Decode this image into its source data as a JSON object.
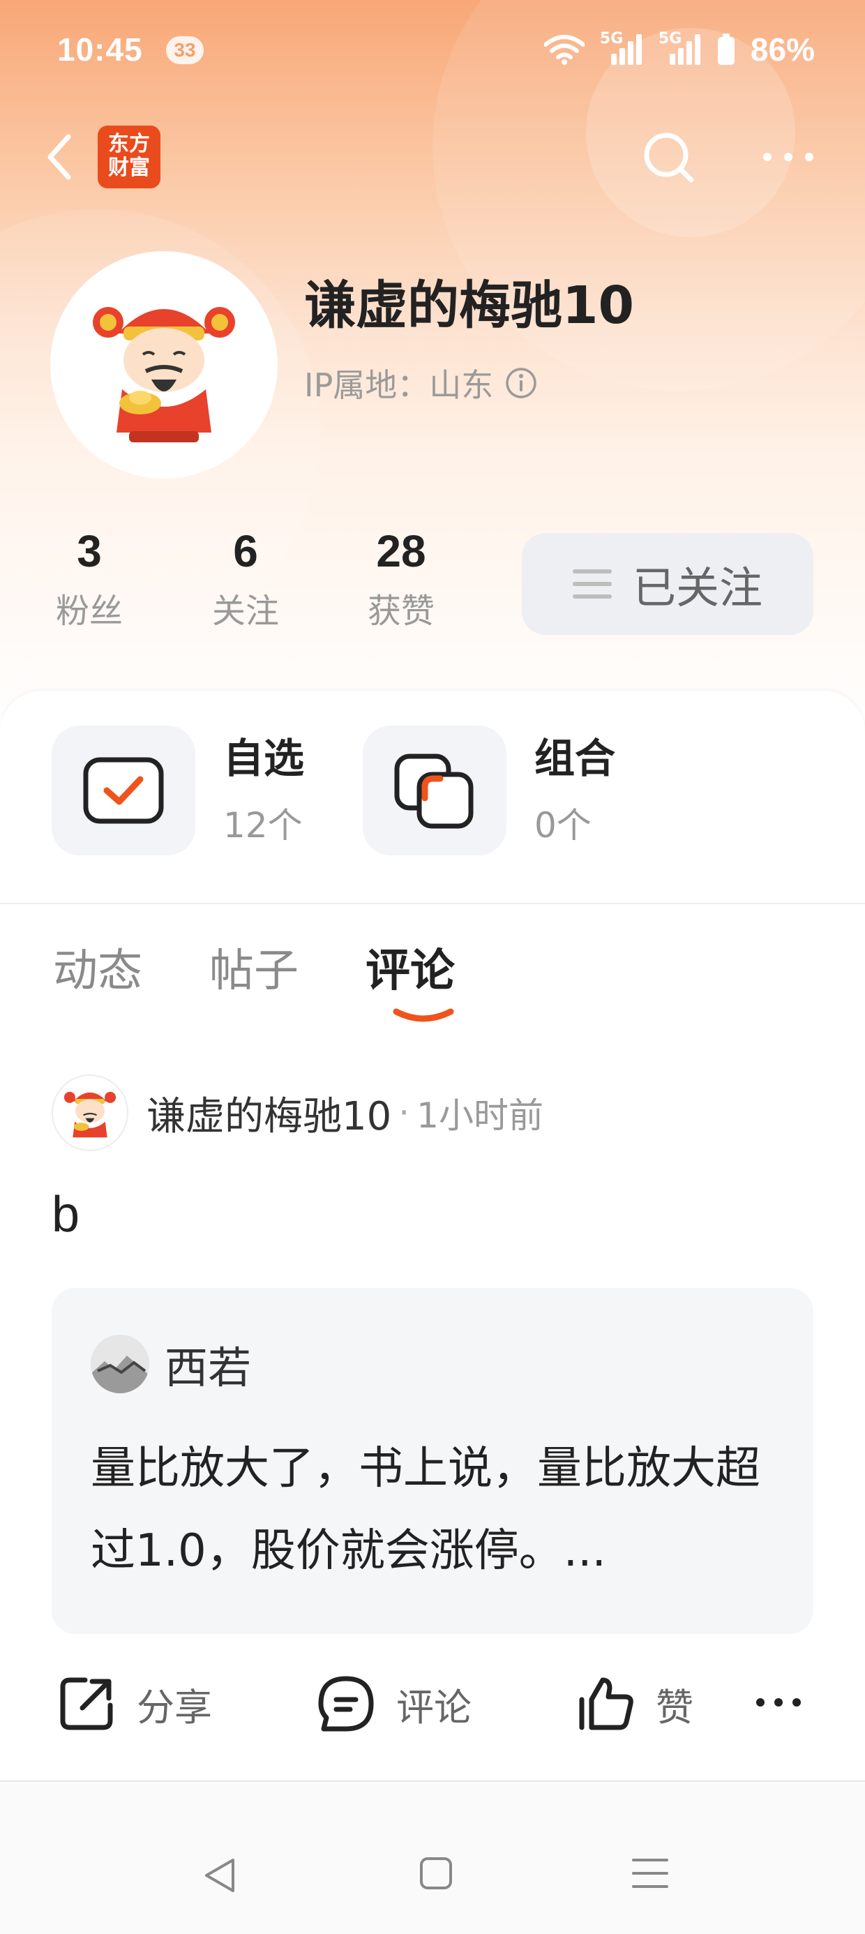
{
  "status_bar": {
    "time": "10:45",
    "badge": "33",
    "network_1": "5G",
    "network_2": "5G",
    "battery": "86%"
  },
  "nav": {
    "back_icon": "chevron-left-icon",
    "app_logo": "东方财富",
    "search_icon": "search-icon",
    "more_icon": "more-dots-icon"
  },
  "profile": {
    "username": "谦虚的梅驰10",
    "ip_location": "IP属地：山东",
    "stats": [
      {
        "value": "3",
        "label": "粉丝"
      },
      {
        "value": "6",
        "label": "关注"
      },
      {
        "value": "28",
        "label": "获赞"
      }
    ],
    "follow_label": "已关注"
  },
  "shortcuts": [
    {
      "title": "自选",
      "count": "12个",
      "icon": "watchlist-check-icon"
    },
    {
      "title": "组合",
      "count": "0个",
      "icon": "portfolio-icon"
    }
  ],
  "tabs": [
    {
      "label": "动态",
      "active": false
    },
    {
      "label": "帖子",
      "active": false
    },
    {
      "label": "评论",
      "active": true
    }
  ],
  "post": {
    "author": "谦虚的梅驰10",
    "separator": "·",
    "time": "1小时前",
    "body": "b",
    "quote": {
      "author": "西若",
      "text": "量比放大了，书上说，量比放大超过1.0，股价就会涨停。..."
    }
  },
  "actions": {
    "share": "分享",
    "comment": "评论",
    "like": "赞",
    "more_icon": "more-dots-icon"
  },
  "colors": {
    "accent": "#f0531c",
    "header_top": "#f8a777",
    "text_primary": "#222222",
    "text_secondary": "#999999"
  }
}
